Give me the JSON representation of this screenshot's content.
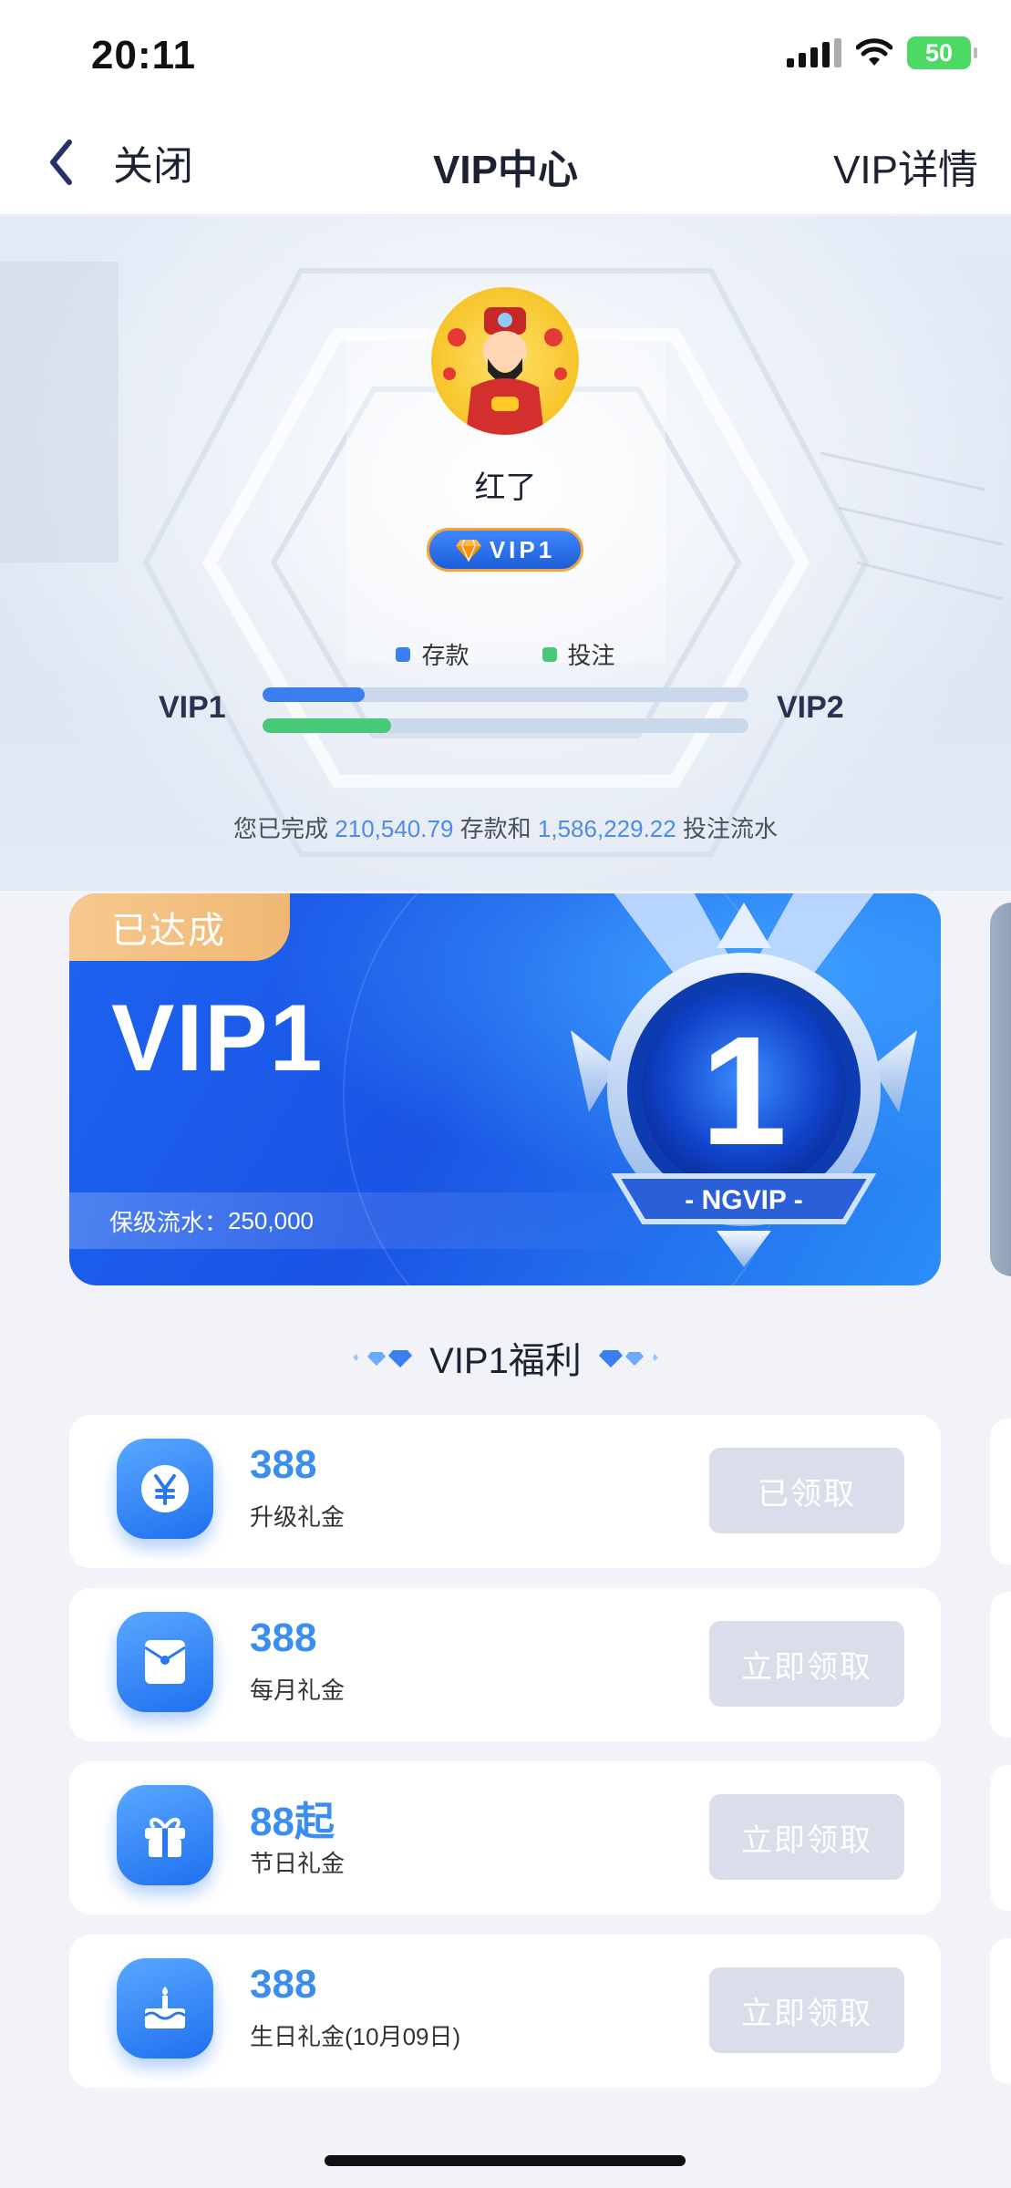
{
  "status_bar": {
    "time": "20:11",
    "battery": "50"
  },
  "nav": {
    "back_label": "关闭",
    "title": "VIP中心",
    "detail_label": "VIP详情"
  },
  "profile": {
    "username": "红了",
    "vip_badge": "VIP1"
  },
  "progress": {
    "legend": [
      {
        "label": "存款",
        "color": "#3a7ff0"
      },
      {
        "label": "投注",
        "color": "#48c97a"
      }
    ],
    "current_level": "VIP1",
    "next_level": "VIP2",
    "deposit_fraction": 0.21,
    "bet_fraction": 0.265,
    "summary_prefix": "您已完成",
    "deposit_amount": "210,540.79",
    "summary_mid": "存款和",
    "bet_amount": "1,586,229.22",
    "summary_suffix": "投注流水"
  },
  "vip_card": {
    "status": "已达成",
    "level": "VIP1",
    "retention_label": "保级流水：",
    "retention_value": "250,000",
    "medal_number": "1",
    "medal_text": "- NGVIP -"
  },
  "benefits": {
    "title": "VIP1福利",
    "items": [
      {
        "amount": "388",
        "label": "升级礼金",
        "button": "已领取",
        "icon": "yen-icon"
      },
      {
        "amount": "388",
        "label": "每月礼金",
        "button": "立即领取",
        "icon": "envelope-icon"
      },
      {
        "amount": "88起",
        "label": "节日礼金",
        "button": "立即领取",
        "icon": "gift-icon"
      },
      {
        "amount": "388",
        "label": "生日礼金(10月09日)",
        "button": "立即领取",
        "icon": "cake-icon"
      }
    ]
  }
}
